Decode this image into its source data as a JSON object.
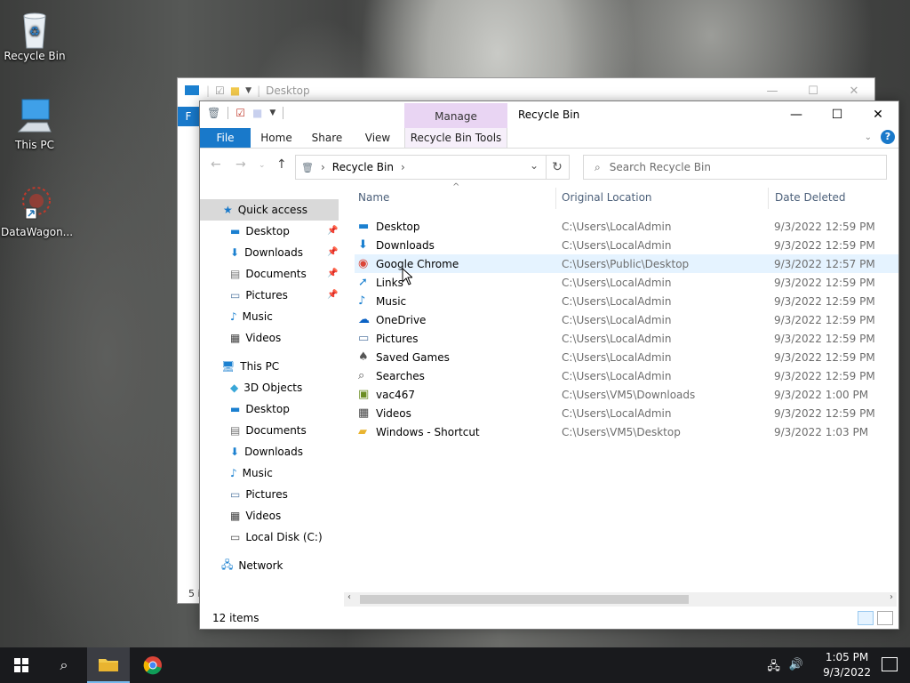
{
  "desktop": {
    "icons": [
      {
        "label": "Recycle Bin",
        "glyph": "🗑"
      },
      {
        "label": "This PC",
        "glyph": "🖥"
      },
      {
        "label": "DataWagon..."
      }
    ]
  },
  "bg_window": {
    "title": "Desktop",
    "file_tab": "F",
    "status": "5 i"
  },
  "window": {
    "manage_tab": "Manage",
    "title": "Recycle Bin",
    "ribbon_tabs": [
      "File",
      "Home",
      "Share",
      "View",
      "Recycle Bin Tools"
    ],
    "address": {
      "root_icon": "recycle-bin",
      "crumb": "Recycle Bin"
    },
    "search_placeholder": "Search Recycle Bin",
    "nav": {
      "quick_access": "Quick access",
      "quick_items": [
        "Desktop",
        "Downloads",
        "Documents",
        "Pictures",
        "Music",
        "Videos"
      ],
      "this_pc": "This PC",
      "pc_items": [
        "3D Objects",
        "Desktop",
        "Documents",
        "Downloads",
        "Music",
        "Pictures",
        "Videos",
        "Local Disk (C:)"
      ],
      "network": "Network"
    },
    "columns": [
      "Name",
      "Original Location",
      "Date Deleted"
    ],
    "rows": [
      {
        "name": "Desktop",
        "location": "C:\\Users\\LocalAdmin",
        "date": "9/3/2022 12:59 PM",
        "icon": "desktop-icon"
      },
      {
        "name": "Downloads",
        "location": "C:\\Users\\LocalAdmin",
        "date": "9/3/2022 12:59 PM",
        "icon": "downloads-icon"
      },
      {
        "name": "Google Chrome",
        "location": "C:\\Users\\Public\\Desktop",
        "date": "9/3/2022 12:57 PM",
        "icon": "chrome-icon",
        "selected": true
      },
      {
        "name": "Links",
        "location": "C:\\Users\\LocalAdmin",
        "date": "9/3/2022 12:59 PM",
        "icon": "links-icon"
      },
      {
        "name": "Music",
        "location": "C:\\Users\\LocalAdmin",
        "date": "9/3/2022 12:59 PM",
        "icon": "music-icon"
      },
      {
        "name": "OneDrive",
        "location": "C:\\Users\\LocalAdmin",
        "date": "9/3/2022 12:59 PM",
        "icon": "onedrive-icon"
      },
      {
        "name": "Pictures",
        "location": "C:\\Users\\LocalAdmin",
        "date": "9/3/2022 12:59 PM",
        "icon": "pictures-icon"
      },
      {
        "name": "Saved Games",
        "location": "C:\\Users\\LocalAdmin",
        "date": "9/3/2022 12:59 PM",
        "icon": "saved-games-icon"
      },
      {
        "name": "Searches",
        "location": "C:\\Users\\LocalAdmin",
        "date": "9/3/2022 12:59 PM",
        "icon": "searches-icon"
      },
      {
        "name": "vac467",
        "location": "C:\\Users\\VM5\\Downloads",
        "date": "9/3/2022 1:00 PM",
        "icon": "application-icon"
      },
      {
        "name": "Videos",
        "location": "C:\\Users\\LocalAdmin",
        "date": "9/3/2022 12:59 PM",
        "icon": "videos-icon"
      },
      {
        "name": "Windows - Shortcut",
        "location": "C:\\Users\\VM5\\Desktop",
        "date": "9/3/2022 1:03 PM",
        "icon": "shortcut-folder-icon"
      }
    ],
    "status": "12 items"
  },
  "taskbar": {
    "time": "1:05 PM",
    "date": "9/3/2022",
    "accent": "#76b9ed"
  }
}
